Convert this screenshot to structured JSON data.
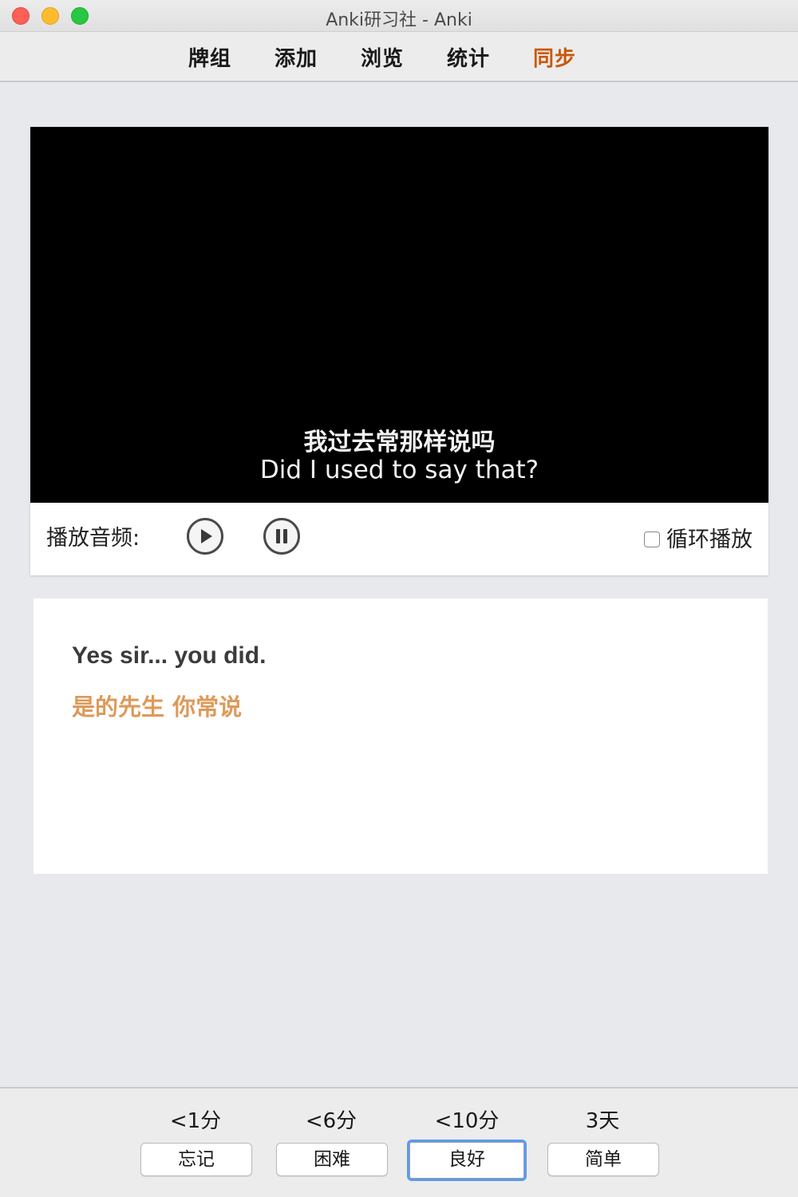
{
  "window": {
    "title": "Anki研习社 - Anki"
  },
  "toolbar": {
    "items": [
      {
        "label": "牌组"
      },
      {
        "label": "添加"
      },
      {
        "label": "浏览"
      },
      {
        "label": "统计"
      },
      {
        "label": "同步",
        "color": "#c8580a"
      }
    ]
  },
  "video": {
    "subtitle_cn": "我过去常那样说吗",
    "subtitle_en": "Did I used to say that?",
    "play_audio_label": "播放音频:",
    "loop_label": "循环播放",
    "loop_checked": false
  },
  "answer": {
    "english": "Yes sir... you did.",
    "chinese": "是的先生 你常说",
    "chinese_color": "#dd9a5a"
  },
  "review": {
    "intervals": [
      "<1分",
      "<6分",
      "<10分",
      "3天"
    ],
    "buttons": [
      "忘记",
      "困难",
      "良好",
      "简单"
    ],
    "focused_index": 2
  }
}
